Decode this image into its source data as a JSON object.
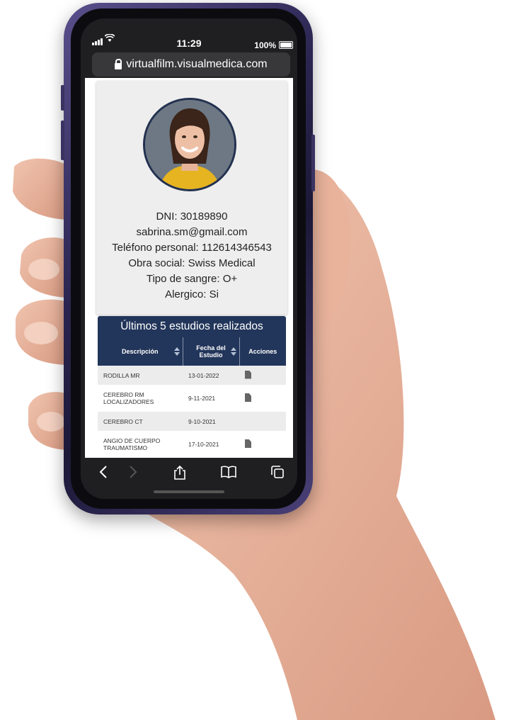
{
  "status_bar": {
    "time": "11:29",
    "battery": "100%"
  },
  "browser": {
    "url": "virtualfilm.visualmedica.com"
  },
  "profile": {
    "lines": [
      "DNI: 30189890",
      "sabrina.sm@gmail.com",
      "Teléfono personal: 112614346543",
      "Obra social: Swiss Medical",
      "Tipo de sangre: O+",
      "Alergico: Si"
    ]
  },
  "studies": {
    "title": "Últimos 5 estudios realizados",
    "columns": [
      "Descripción",
      "Fecha del Estudio",
      "Acciones"
    ],
    "rows": [
      {
        "desc": "RODILLA MR",
        "date": "13-01-2022",
        "has_file": true
      },
      {
        "desc": "CEREBRO RM LOCALIZADORES",
        "date": "9-11-2021",
        "has_file": true
      },
      {
        "desc": "CEREBRO CT",
        "date": "9-10-2021",
        "has_file": false
      },
      {
        "desc": "ANGIO DE CUERPO TRAUMATISMO",
        "date": "17-10-2021",
        "has_file": true
      }
    ]
  },
  "colors": {
    "header": "#22355a",
    "row_alt": "#ececec",
    "phone_frame": "#2a2550"
  },
  "icons": [
    "lock-icon",
    "file-icon",
    "sort-icon",
    "back-icon",
    "forward-icon",
    "share-icon",
    "bookmarks-icon",
    "tabs-icon"
  ]
}
